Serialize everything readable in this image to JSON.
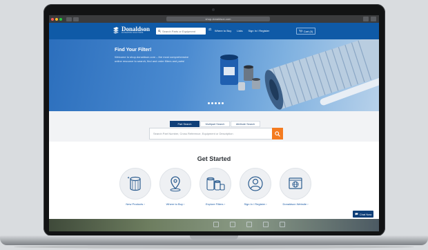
{
  "browser": {
    "url": "shop.donaldson.com"
  },
  "header": {
    "logo_name": "Donaldson",
    "logo_tagline": "FILTRATION SOLUTIONS",
    "search_placeholder": "Search Parts or Equipment",
    "nav": [
      "Where to Buy",
      "Lists",
      "Sign In / Register"
    ],
    "cart_label": "Cart (0)"
  },
  "hero": {
    "title": "Find Your Filter!",
    "text": "Welcome to shop.donaldson.com – the most comprehensive online resource to search, find and order filters and parts!",
    "slide_count": 5
  },
  "search": {
    "tabs": [
      "Part Search",
      "Multipart Search",
      "Attribute Search"
    ],
    "active_tab": 0,
    "placeholder": "Search Part Number, Cross Reference, Equipment or Description"
  },
  "get_started": {
    "title": "Get Started",
    "items": [
      {
        "label": "New Products ›",
        "icon": "filter-icon"
      },
      {
        "label": "Where to Buy ›",
        "icon": "location-pin-icon"
      },
      {
        "label": "Explore Filters ›",
        "icon": "filters-group-icon"
      },
      {
        "label": "Sign In / Register ›",
        "icon": "user-icon"
      },
      {
        "label": "Donaldson Website ›",
        "icon": "globe-window-icon"
      }
    ]
  },
  "chat": {
    "label": "Chat Now"
  },
  "colors": {
    "brand_blue": "#0f5aa7",
    "dark_blue": "#0f3f78",
    "accent_orange": "#f47b20"
  }
}
